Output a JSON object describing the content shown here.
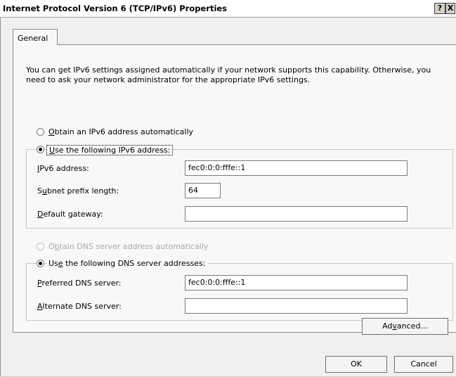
{
  "window": {
    "title": "Internet Protocol Version 6 (TCP/IPv6) Properties",
    "help_glyph": "?",
    "close_glyph": "X"
  },
  "tabs": {
    "general": "General"
  },
  "intro_text": "You can get IPv6 settings assigned automatically if your network supports this capability. Otherwise, you need to ask your network administrator for the appropriate IPv6 settings.",
  "ip": {
    "auto": {
      "key": "O",
      "rest": "btain an IPv6 address automatically",
      "selected": false
    },
    "manual": {
      "key": "U",
      "rest": "se the following IPv6 address:",
      "selected": true
    },
    "address": {
      "key": "I",
      "rest": "Pv6 address:",
      "value": "fec0:0:0:fffe::1"
    },
    "prefix": {
      "pre": "S",
      "key": "u",
      "rest": "bnet prefix length:",
      "value": "64"
    },
    "gateway": {
      "key": "D",
      "rest": "efault gateway:",
      "value": ""
    }
  },
  "dns": {
    "auto": {
      "pre": "O",
      "key": "b",
      "rest": "tain DNS server address automatically",
      "enabled": false
    },
    "manual": {
      "pre": "Us",
      "key": "e",
      "rest": " the following DNS server addresses:",
      "selected": true
    },
    "preferred": {
      "key": "P",
      "rest": "referred DNS server:",
      "value": "fec0:0:0:fffe::1"
    },
    "alternate": {
      "key": "A",
      "rest": "lternate DNS server:",
      "value": ""
    }
  },
  "buttons": {
    "advanced": {
      "pre": "Ad",
      "key": "v",
      "rest": "anced..."
    },
    "ok": "OK",
    "cancel": "Cancel"
  }
}
